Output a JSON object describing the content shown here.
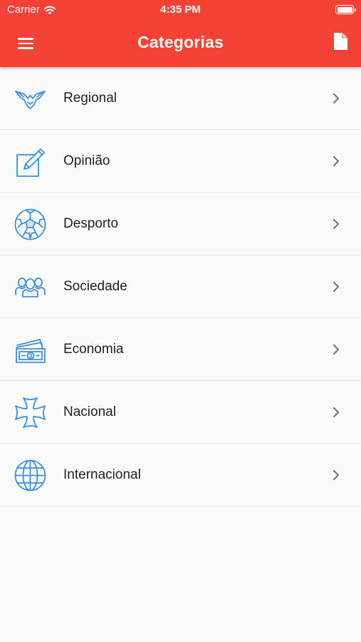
{
  "status": {
    "carrier": "Carrier",
    "time": "4:35 PM"
  },
  "header": {
    "title": "Categorias",
    "color": "#f44336",
    "left_icon": "hamburger-menu-icon",
    "right_icon": "document-icon"
  },
  "categories": [
    {
      "label": "Regional",
      "icon": "eagle-icon"
    },
    {
      "label": "Opinião",
      "icon": "pen-on-square-icon"
    },
    {
      "label": "Desporto",
      "icon": "soccer-ball-icon"
    },
    {
      "label": "Sociedade",
      "icon": "people-group-icon"
    },
    {
      "label": "Economia",
      "icon": "banknotes-icon"
    },
    {
      "label": "Nacional",
      "icon": "cross-icon"
    },
    {
      "label": "Internacional",
      "icon": "globe-icon"
    }
  ],
  "icon_color": "#3a8fe0"
}
